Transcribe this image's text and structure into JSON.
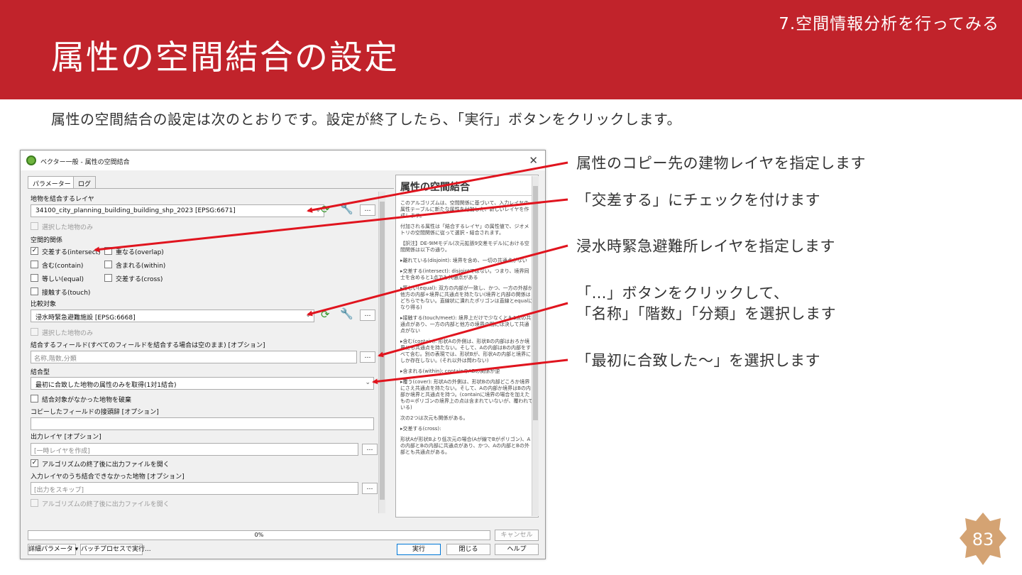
{
  "slide": {
    "chapter": "7.空間情報分析を行ってみる",
    "title": "属性の空間結合の設定",
    "intro": "属性の空間結合の設定は次のとおりです。設定が終了したら、「実行」ボタンをクリックします。",
    "page_number": "83",
    "accent_color": "#c1232b",
    "badge_color": "#d4a373"
  },
  "dialog": {
    "title": "ベクター一般 - 属性の空間結合",
    "tabs": [
      "パラメーター",
      "ログ"
    ],
    "input_layer_label": "地物を結合するレイヤ",
    "input_layer_value": "34100_city_planning_building_building_shp_2023 [EPSG:6671]",
    "selected_only_1": "選択した地物のみ",
    "spatial_relation_label": "空間的関係",
    "relations": [
      {
        "label": "交差する(intersect)",
        "checked": true
      },
      {
        "label": "重なる(overlap)",
        "checked": false
      },
      {
        "label": "含む(contain)",
        "checked": false
      },
      {
        "label": "含まれる(within)",
        "checked": false
      },
      {
        "label": "等しい(equal)",
        "checked": false
      },
      {
        "label": "交差する(cross)",
        "checked": false
      },
      {
        "label": "接触する(touch)",
        "checked": false
      }
    ],
    "join_layer_label": "比較対象",
    "join_layer_value": "浸水時緊急避難施設 [EPSG:6668]",
    "selected_only_2": "選択した地物のみ",
    "fields_label": "結合するフィールド(すべてのフィールドを結合する場合は空のまま) [オプション]",
    "fields_value": "名称,階数,分類",
    "join_type_label": "結合型",
    "join_type_value": "最初に合致した地物の属性のみを取得(1対1結合)",
    "discard_label": "結合対象がなかった地物を破棄",
    "prefix_label": "コピーしたフィールドの接頭辞 [オプション]",
    "output_label": "出力レイヤ [オプション]",
    "output_placeholder": "[一時レイヤを作成]",
    "open_output_label": "アルゴリズムの終了後に出力ファイルを開く",
    "unjoinable_label": "入力レイヤのうち結合できなかった地物 [オプション]",
    "unjoinable_placeholder": "[出力をスキップ]",
    "open_output_label_2": "アルゴリズムの終了後に出力ファイルを開く",
    "progress": "0%",
    "cancel": "キャンセル",
    "advanced": "詳細パラメータ ▾",
    "batch": "バッチプロセスで実行...",
    "run": "実行",
    "close": "閉じる",
    "help": "ヘルプ",
    "help_title": "属性の空間結合",
    "help_paragraphs": [
      "このアルゴリズムは、空間関係に基づいて、入力レイヤの属性テーブルに新たな属性を付加した、新しいレイヤを作成します。",
      "付加される属性は「結合するレイヤ」の属性値で、ジオメトリの空間関係に従って選択・結合されます。",
      "【訳注】DE-9IMモデル(次元拡張9交差モデル)における空間関係は以下の通り。",
      "▸離れている(disjoint): 境界を含め、一切の共通点がない",
      "▸交差する(intersect): disjointではない。つまり、境界同士を含めると1点でも共通点がある",
      "▸等しい(equal): 双方の内部が一致し、かつ、一方の外部が他方の内部+境界に共通点を持たない(境界と内部の関係はどちらでもない。直線状に潰れたポリゴンは直線とequalになり得る)",
      "▸接触する(touch/meet): 境界上だけで少なくとも1点の共通点があり、一方の内部と他方の境界の間には決して共通点がない",
      "▸含む(contain): 形状Aの外側は、形状Bの内部はおろか境界にも共通点を持たない。そして、Aの内部はBの内部をすべて含む。別の表現では、形状Bが、形状Aの内部と境界にしか存在しない。(それ以外は問わない)",
      "▸含まれる(within): containのABの関係が逆",
      "▸覆う(cover): 形状Aの外側は、形状Bの内部どころか境界にさえ共通点を持たない。そして、Aの内部か境界はBの内部か境界と共通点を持つ。(containに境界の場合を加えたもの=ポリゴンの境界上の点は含まれていないが、覆われている)",
      "次の2つは次元も関係がある。",
      "▸交差する(cross):",
      "形状Aが形状Bより低次元の場合(Aが線でBがポリゴン)、Aの内部とBの内部に共通点があり、かつ、Aの内部とBの外部とも共通点がある。"
    ]
  },
  "callouts": [
    "属性のコピー先の建物レイヤを指定します",
    "「交差する」にチェックを付けます",
    "浸水時緊急避難所レイヤを指定します",
    "「…」ボタンをクリックして、",
    "「名称」「階数」「分類」を選択します",
    "「最初に合致した～」を選択します"
  ],
  "arrow_color": "#e0141e"
}
